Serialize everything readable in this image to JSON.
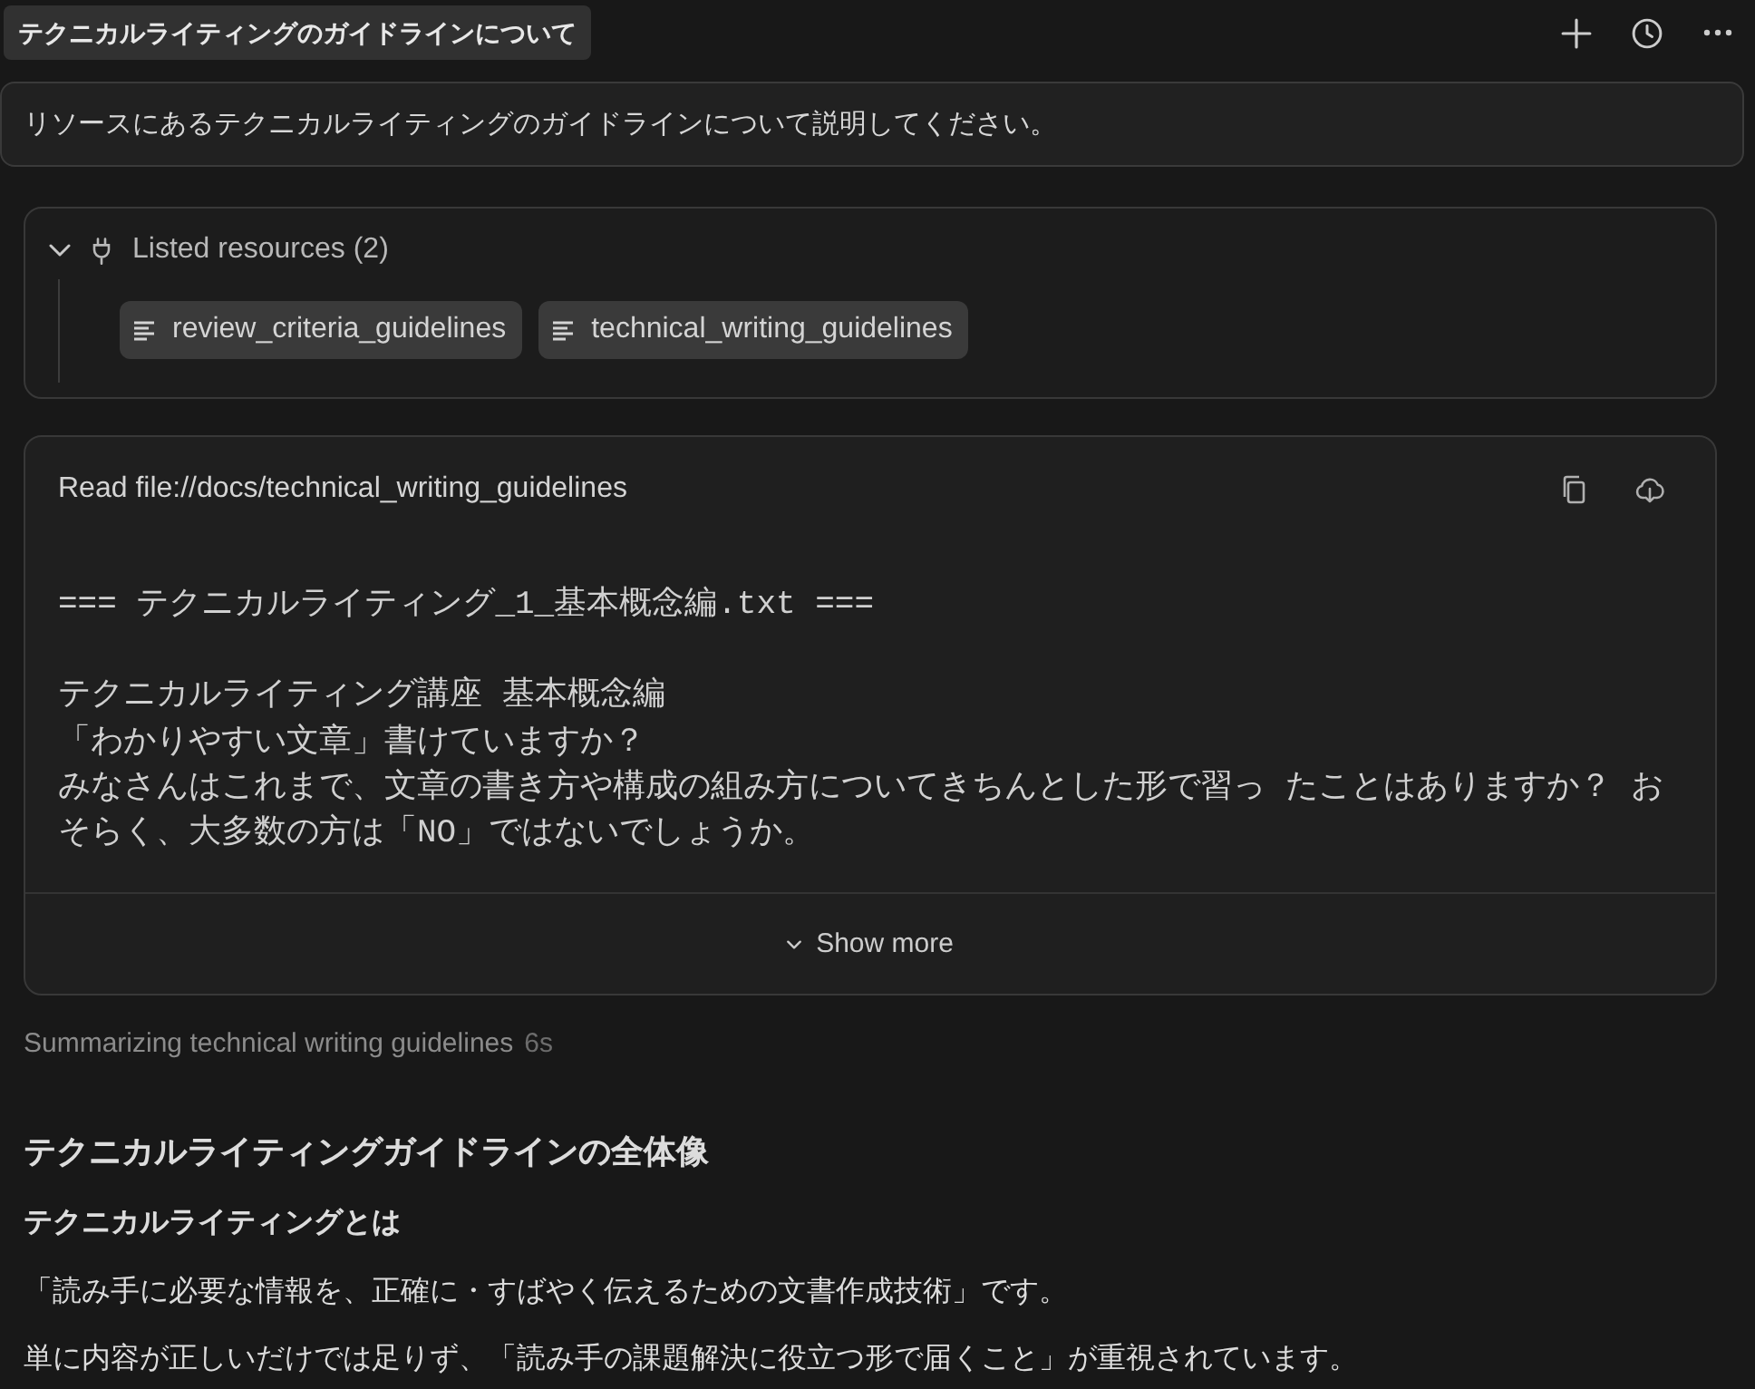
{
  "header": {
    "title": "テクニカルライティングのガイドラインについて"
  },
  "user_message": {
    "text": "リソースにあるテクニカルライティングのガイドラインについて説明してください。"
  },
  "resources": {
    "label": "Listed resources (2)",
    "expanded": true,
    "items": [
      {
        "name": "review_criteria_guidelines"
      },
      {
        "name": "technical_writing_guidelines"
      }
    ]
  },
  "file_read": {
    "title": "Read file://docs/technical_writing_guidelines",
    "content_header": "=== テクニカルライティング_1_基本概念編.txt ===",
    "lines": [
      "テクニカルライティング講座 基本概念編",
      "「わかりやすい文章」書けていますか？",
      "みなさんはこれまで、文章の書き方や構成の組み方についてきちんとした形で習っ たことはありますか？ おそらく、大多数の方は「NO」ではないでしょうか。"
    ],
    "show_more": "Show more"
  },
  "status": {
    "text": "Summarizing technical writing guidelines",
    "duration": "6s"
  },
  "response": {
    "blocks": [
      {
        "kind": "heading",
        "text": "テクニカルライティングガイドラインの全体像"
      },
      {
        "kind": "subheading",
        "text": "テクニカルライティングとは"
      },
      {
        "kind": "paragraph",
        "text": "「読み手に必要な情報を、正確に・すばやく伝えるための文書作成技術」です。"
      },
      {
        "kind": "paragraph",
        "text": "単に内容が正しいだけでは足りず、「読み手の課題解決に役立つ形で届くこと」が重視されています。"
      }
    ]
  }
}
